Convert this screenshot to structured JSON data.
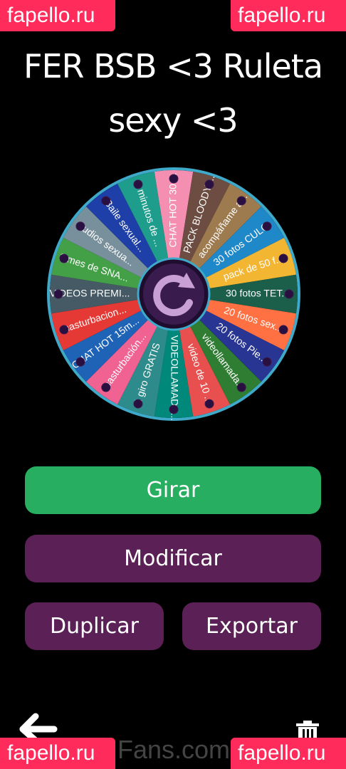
{
  "watermark": "fapello.ru",
  "footer_watermark": "Fans.com",
  "title": "FER BSB <3 Ruleta sexy <3",
  "wheel": {
    "segments": [
      {
        "label": "CHAT HOT 30 ...",
        "color": "#f48fb1"
      },
      {
        "label": "PACK BLOODY ...",
        "color": "#6d4c41"
      },
      {
        "label": "acompáñame a...",
        "color": "#9e7a4f"
      },
      {
        "label": "30 fotos CULO",
        "color": "#1e88c8"
      },
      {
        "label": "pack de 50 f...",
        "color": "#f2b632"
      },
      {
        "label": "30 fotos TET...",
        "color": "#1b5e4a"
      },
      {
        "label": "20 fotos sex...",
        "color": "#ff7043"
      },
      {
        "label": "20 fotos Pie...",
        "color": "#283593"
      },
      {
        "label": "videollamada...",
        "color": "#2e7d32"
      },
      {
        "label": "video de 10 ...",
        "color": "#e84f4f"
      },
      {
        "label": "VIDEOLLAMADA...",
        "color": "#00897b"
      },
      {
        "label": "1 giro GRATIS",
        "color": "#2e8b8b"
      },
      {
        "label": "masturbación...",
        "color": "#f06292"
      },
      {
        "label": "CHAT HOT 15m...",
        "color": "#1e63b5"
      },
      {
        "label": "masturbacion...",
        "color": "#e53935"
      },
      {
        "label": "VIDEOS PREMI...",
        "color": "#455a64"
      },
      {
        "label": "1 mes de SNA...",
        "color": "#43a047"
      },
      {
        "label": "audios sexua...",
        "color": "#78909c"
      },
      {
        "label": "Baile sexual...",
        "color": "#1e3fa8"
      },
      {
        "label": "3 minutos de ...",
        "color": "#1e9c8c"
      }
    ],
    "center_icon": "refresh-icon",
    "rim_color": "#3fa9c9"
  },
  "buttons": {
    "spin": "Girar",
    "edit": "Modificar",
    "duplicate": "Duplicar",
    "export": "Exportar"
  },
  "icons": {
    "back": "back-arrow-icon",
    "delete": "trash-icon"
  }
}
